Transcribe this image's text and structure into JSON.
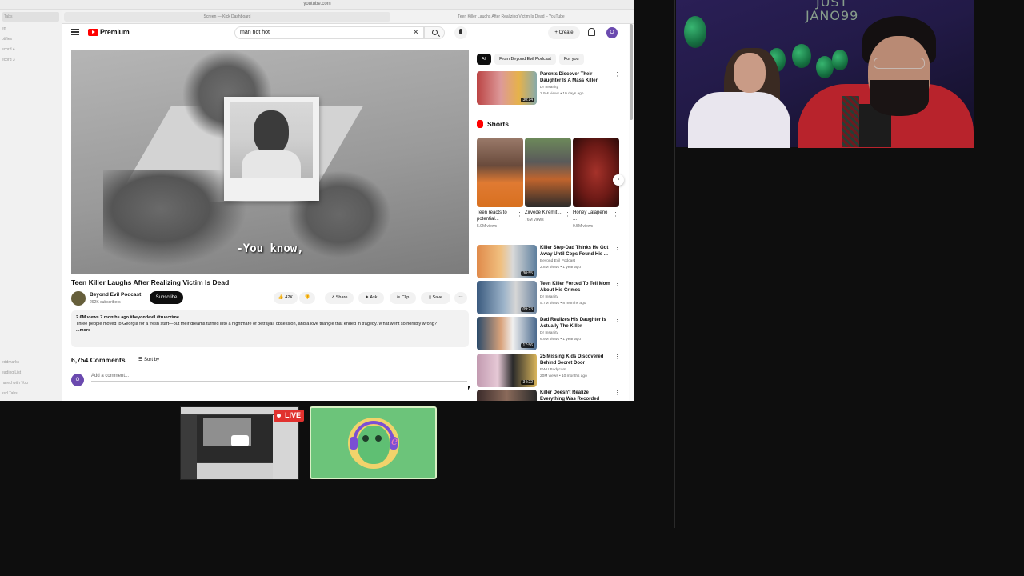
{
  "browser": {
    "url": "youtube.com",
    "tabs": [
      "Screen — Kick Dashboard",
      "Teen Killer Laughs After Realizing Victim Is Dead – YouTube"
    ],
    "sidebar": [
      "Tabs",
      "",
      "en",
      "otifies",
      "ecord 4",
      "ecord 3"
    ],
    "sidebar_bottom": [
      "eddmarks",
      "eading List",
      "hared with You",
      "ssd Tabs"
    ]
  },
  "youtube": {
    "logo": "Premium",
    "search_value": "man not hot",
    "create_label": "+ Create",
    "avatar_letter": "O",
    "video": {
      "caption": "-You know,",
      "title": "Teen Killer Laughs After Realizing Victim Is Dead",
      "channel": "Beyond Evil Podcast",
      "subscribers": "292K subscribers",
      "subscribe_label": "Subscribe",
      "likes": "42K",
      "actions": [
        "Share",
        "Ask",
        "Clip",
        "Save"
      ],
      "desc_meta": "2.6M views  7 months ago  #beyondevil #truecrime",
      "desc_text": "Three people moved to Georgia for a fresh start—but their dreams turned into a nightmare of betrayal, obsession, and a love triangle that ended in tragedy. What went so horribly wrong?",
      "desc_more": "...more"
    },
    "comments": {
      "count_label": "6,754 Comments",
      "sort_label": "Sort by",
      "avatar_letter": "O",
      "placeholder": "Add a comment..."
    },
    "chips": [
      "All",
      "From Beyond Evil Podcast",
      "For you"
    ],
    "recommendations_top": [
      {
        "title": "Parents Discover Their Daughter Is A Mass Killer",
        "channel": "Dr Insanity",
        "meta": "2.9M views • 10 days ago",
        "duration": "30:14"
      }
    ],
    "shorts_heading": "Shorts",
    "shorts": [
      {
        "title": "Teen reacts to potential...",
        "views": "5.9M views"
      },
      {
        "title": "Zirvede Kiremit ...",
        "views": "76M views"
      },
      {
        "title": "Honey Jalapeno ...",
        "views": "9.5M views"
      }
    ],
    "recommendations": [
      {
        "title": "Killer Step-Dad Thinks He Got Away Until Cops Found His ...",
        "channel": "Beyond Evil Podcast",
        "meta": "2.8M views • 1 year ago",
        "duration": "30:55"
      },
      {
        "title": "Teen Killer Forced To Tell Mom About His Crimes",
        "channel": "Dr Insanity",
        "meta": "5.7M views • 8 months ago",
        "duration": "09:23"
      },
      {
        "title": "Dad Realizes His Daughter Is Actually The Killer",
        "channel": "Dr Insanity",
        "meta": "6.9M views • 1 year ago",
        "duration": "17:56"
      },
      {
        "title": "25 Missing Kids Discovered Behind Secret Door",
        "channel": "EWU Bodycam",
        "meta": "20M views • 10 months ago",
        "duration": "34:22"
      },
      {
        "title": "Killer Doesn't Realize Everything Was Recorded",
        "channel": "",
        "meta": "",
        "duration": ""
      }
    ]
  },
  "webcam": {
    "neon_text": [
      "JUST",
      "JANO99"
    ]
  },
  "live_badge": "LIVE",
  "colors": {
    "youtube_red": "#ff0000",
    "live_red": "#e1322f",
    "avatar_purple": "#6b4aaf",
    "tile_green": "#6cc47a"
  }
}
